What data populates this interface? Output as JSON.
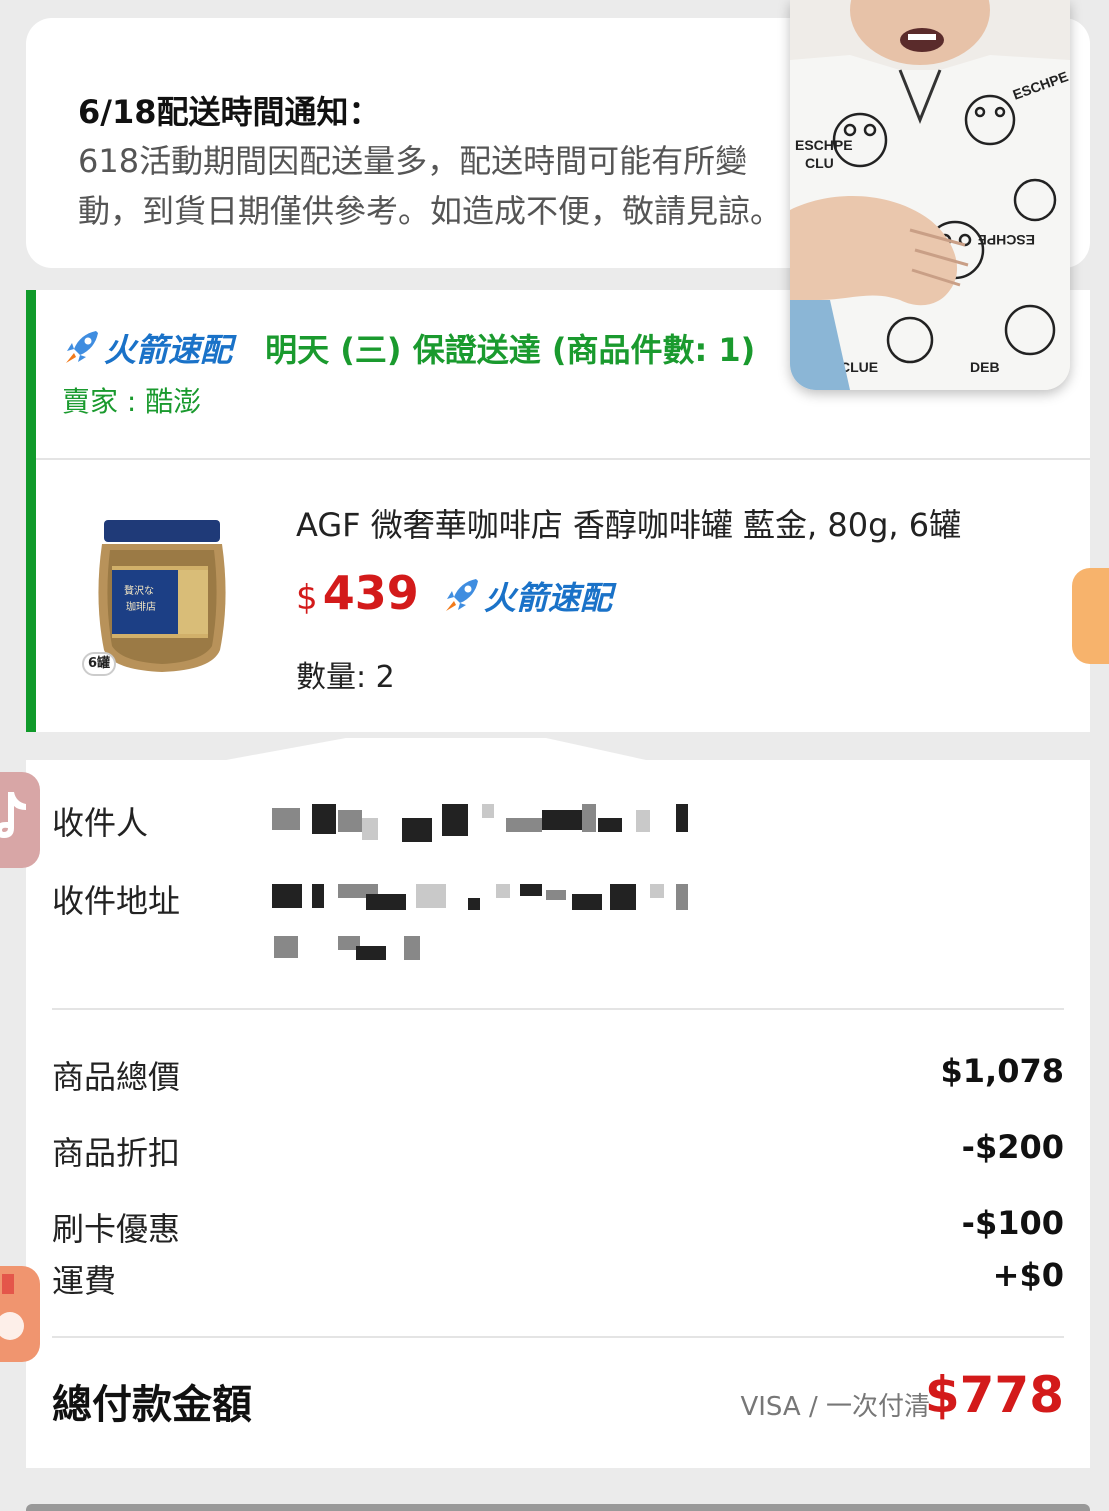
{
  "notice": {
    "title": "6/18配送時間通知：",
    "body": "618活動期間因配送量多，配送時間可能有所變動，到貨日期僅供參考。如造成不便，敬請見諒。"
  },
  "shipment": {
    "rocket_label": "火箭速配",
    "guarantee": "明天 (三) 保證送達 (商品件數: 1)",
    "seller": "賣家 : 酷澎"
  },
  "product": {
    "name": "AGF 微奢華咖啡店 香醇咖啡罐 藍金, 80g, 6罐",
    "currency": "$",
    "price": "439",
    "rocket_label": "火箭速配",
    "quantity": "數量: 2",
    "image_badge": "6罐"
  },
  "recipient": {
    "name_label": "收件人",
    "address_label": "收件地址"
  },
  "summary": {
    "items": [
      {
        "label": "商品總價",
        "value": "$1,078"
      },
      {
        "label": "商品折扣",
        "value": "-$200"
      },
      {
        "label": "刷卡優惠",
        "value": "-$100"
      },
      {
        "label": "運費",
        "value": "+$0"
      }
    ],
    "total_label": "總付款金額",
    "pay_method": "VISA / 一次付清",
    "total_value": "$778"
  },
  "colors": {
    "accent_green": "#1a9a2e",
    "price_red": "#d31a1a",
    "rocket_blue": "#1a72c8"
  }
}
